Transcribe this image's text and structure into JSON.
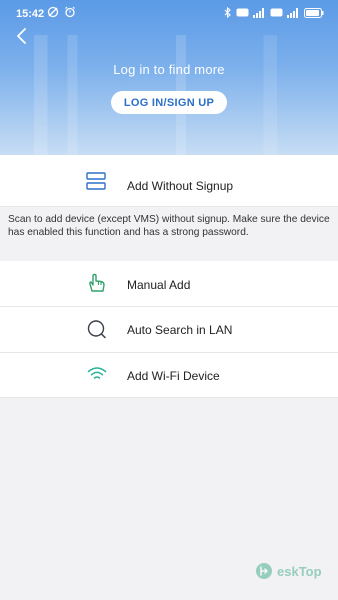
{
  "status_bar": {
    "time": "15:42",
    "right_labels": [
      "HD",
      "HD",
      "4G",
      "5G"
    ]
  },
  "header": {
    "prompt": "Log in to find more",
    "login_button": "LOG IN/SIGN UP"
  },
  "add_without_signup": {
    "label": "Add Without Signup",
    "description": "Scan to add device (except VMS) without signup. Make sure the device has enabled this function and has a strong password."
  },
  "options": [
    {
      "label": "Manual Add",
      "icon": "hand-pointer-icon"
    },
    {
      "label": "Auto Search in LAN",
      "icon": "search-bubble-icon"
    },
    {
      "label": "Add Wi-Fi Device",
      "icon": "wifi-icon"
    }
  ],
  "watermark": {
    "text": "eskTop"
  },
  "colors": {
    "accent": "#2c6fc8",
    "green": "#34a36b",
    "teal": "#28b39a"
  }
}
